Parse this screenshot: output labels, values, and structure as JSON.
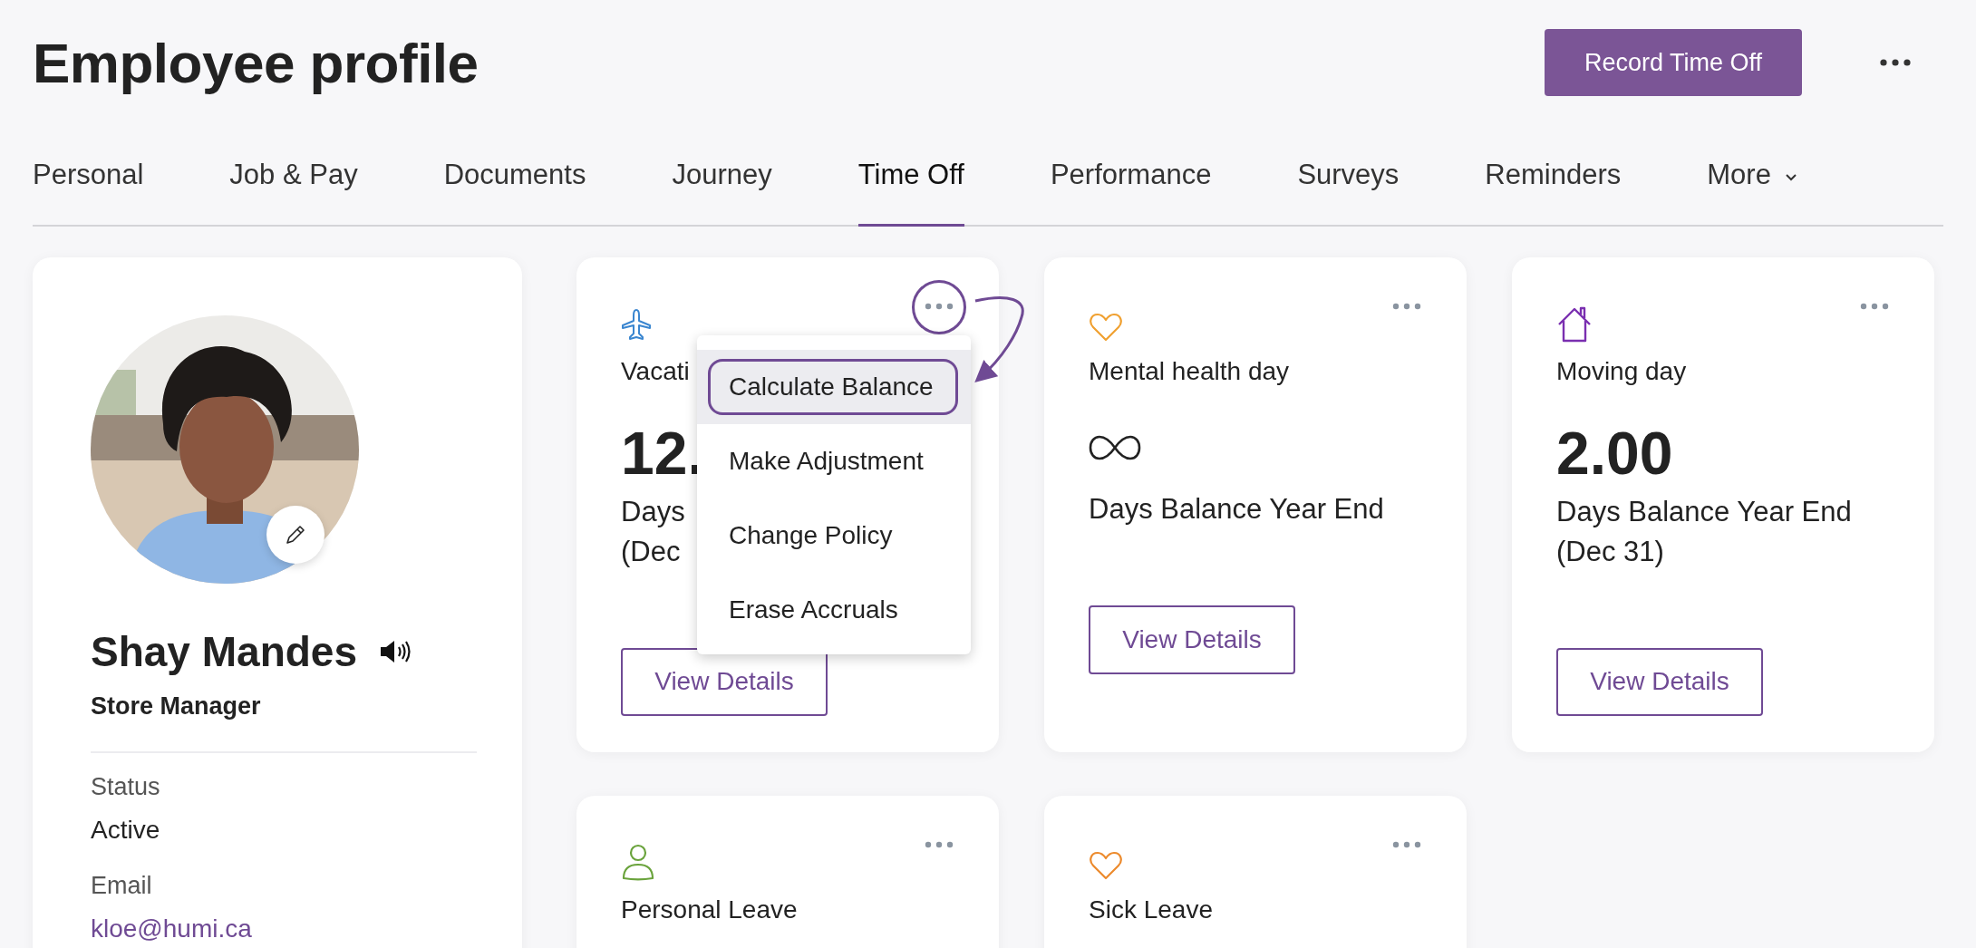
{
  "page": {
    "title": "Employee profile",
    "primary_button": "Record Time Off"
  },
  "tabs": [
    {
      "label": "Personal",
      "selected": false,
      "kind": "tab"
    },
    {
      "label": "Job & Pay",
      "selected": false,
      "kind": "tab"
    },
    {
      "label": "Documents",
      "selected": false,
      "kind": "tab"
    },
    {
      "label": "Journey",
      "selected": false,
      "kind": "tab"
    },
    {
      "label": "Time Off",
      "selected": true,
      "kind": "tab"
    },
    {
      "label": "Performance",
      "selected": false,
      "kind": "tab"
    },
    {
      "label": "Surveys",
      "selected": false,
      "kind": "tab"
    },
    {
      "label": "Reminders",
      "selected": false,
      "kind": "tab"
    },
    {
      "label": "More",
      "selected": false,
      "kind": "dropdown"
    }
  ],
  "profile": {
    "name": "Shay Mandes",
    "job_title": "Store Manager",
    "fields": [
      {
        "label": "Status",
        "value": "Active",
        "kind": "text"
      },
      {
        "label": "Email",
        "value": "kloe@humi.ca",
        "kind": "link"
      }
    ]
  },
  "cards": [
    {
      "title": "Vacati",
      "color": "#3a86d0",
      "kind": "number",
      "balance": "12.",
      "caption": [
        "Days",
        "(Dec"
      ],
      "button": "View Details",
      "menu_open": true
    },
    {
      "title": "Mental health day",
      "color": "#f0a030",
      "kind": "unlimited",
      "caption": [
        "Days Balance Year End"
      ],
      "button": "View Details",
      "menu_open": false
    },
    {
      "title": "Moving day",
      "color": "#7a2fb0",
      "kind": "number",
      "balance": "2.00",
      "caption": [
        "Days Balance Year End",
        "(Dec 31)"
      ],
      "button": "View Details",
      "menu_open": false
    },
    {
      "title": "Personal Leave",
      "color": "#6aa33c",
      "kind": "heading",
      "menu_open": false
    },
    {
      "title": "Sick Leave",
      "color": "#ec8a2c",
      "kind": "heading",
      "menu_open": false
    }
  ],
  "menu": {
    "items": [
      {
        "label": "Calculate Balance",
        "selected": true
      },
      {
        "label": "Make Adjustment",
        "selected": false
      },
      {
        "label": "Change Policy",
        "selected": false
      },
      {
        "label": "Erase Accruals",
        "selected": false
      }
    ]
  }
}
